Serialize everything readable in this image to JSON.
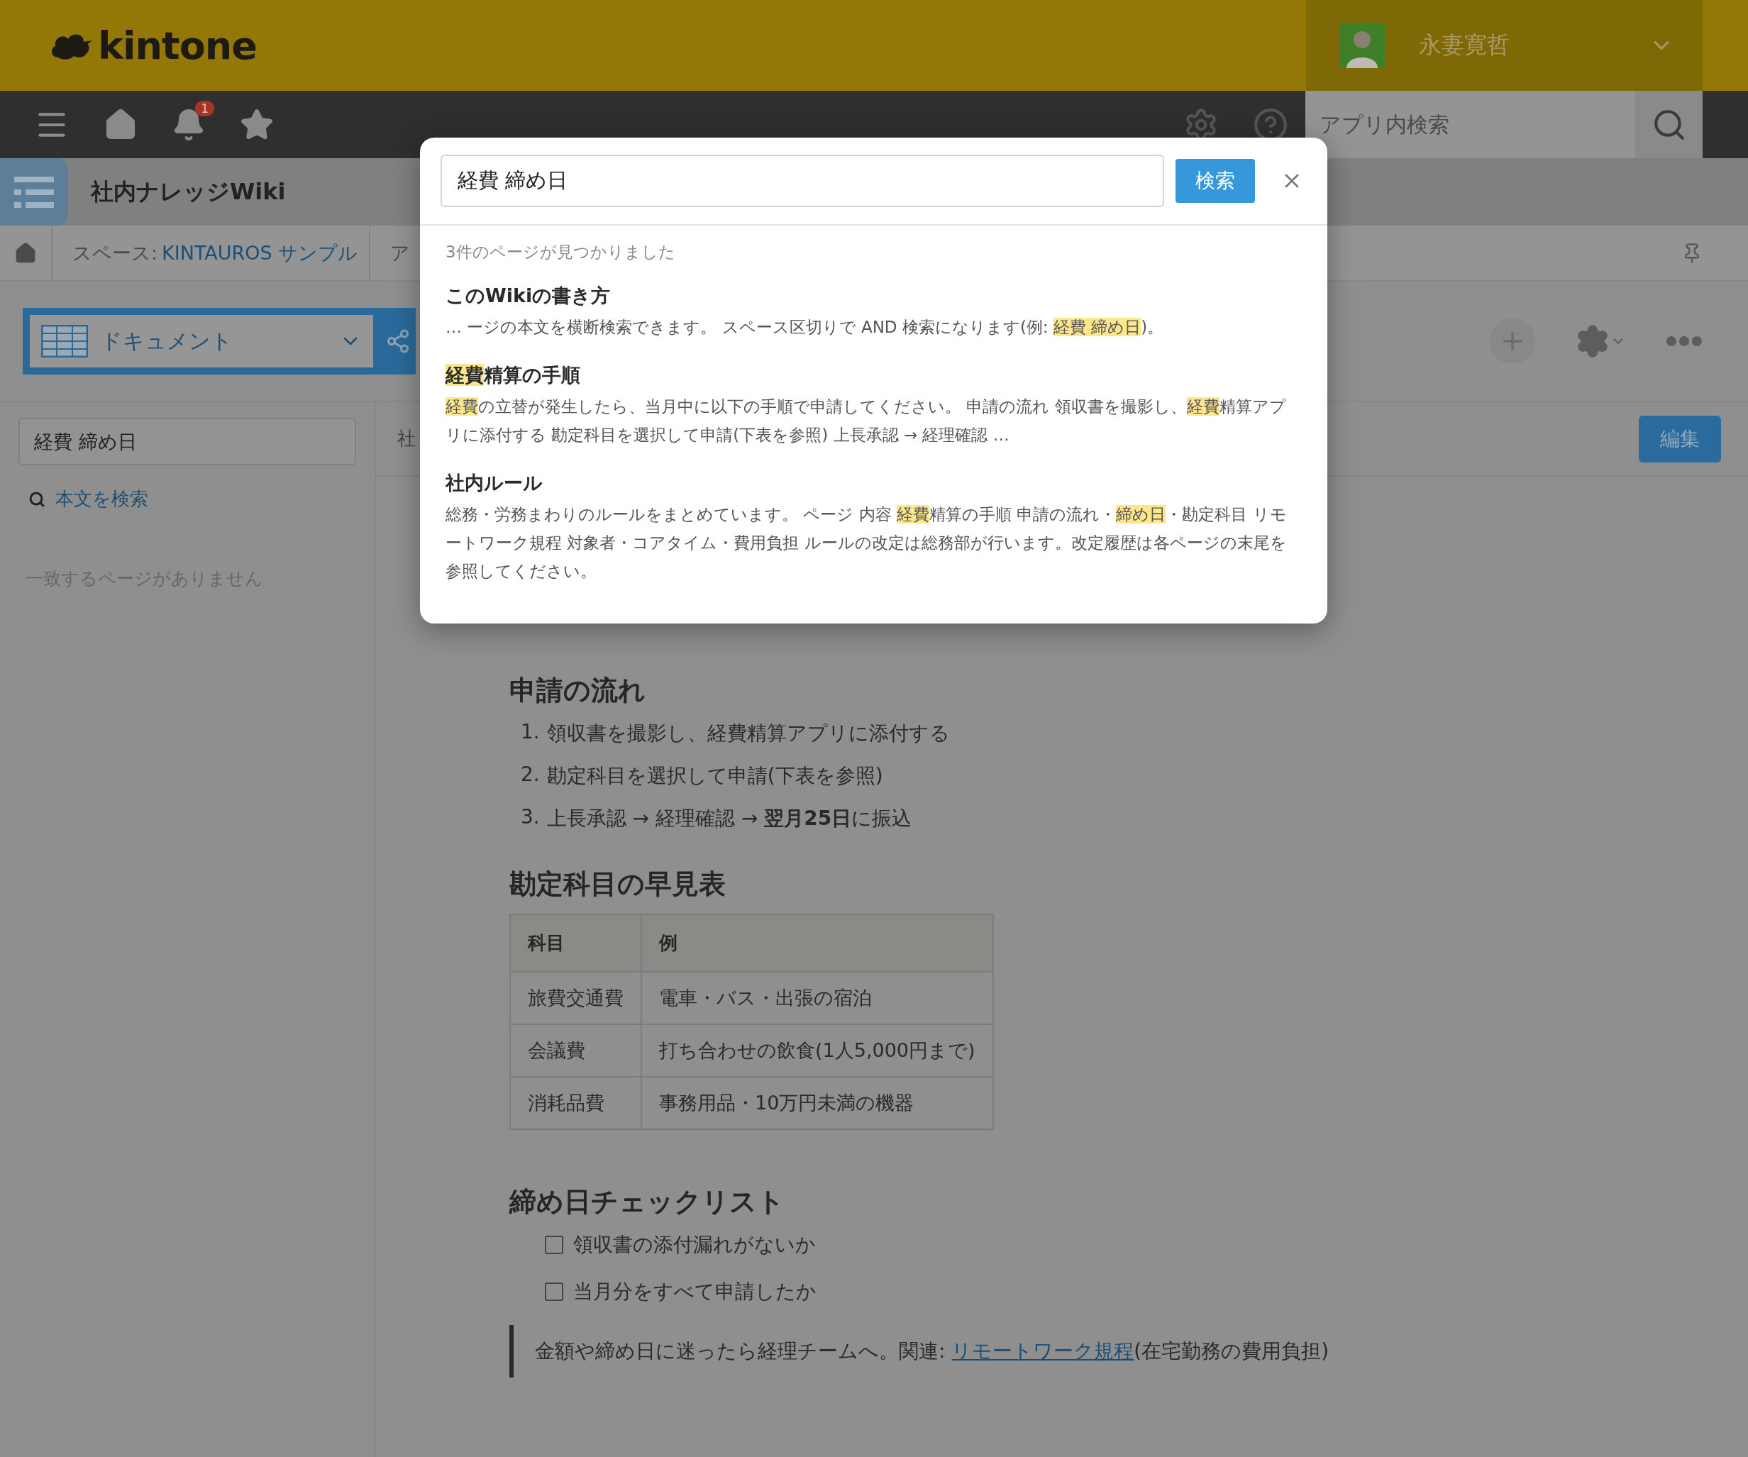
{
  "header": {
    "logo": "kintone",
    "user": {
      "name": "永妻寛哲"
    }
  },
  "nav": {
    "notification_count": "1",
    "search": {
      "placeholder": "アプリ内検索"
    }
  },
  "app": {
    "title": "社内ナレッジWiki"
  },
  "breadcrumb": [
    {
      "label": "スペース:",
      "link": "KINTAUROS サンプル"
    },
    {
      "label": "ア"
    }
  ],
  "view_selector": {
    "label": "ドキュメント"
  },
  "sidebar": {
    "search_value": "経費 締め日",
    "body_search_link": "本文を検索",
    "empty_message": "一致するページがありません"
  },
  "content": {
    "title": "社",
    "edit_button": "編集",
    "blocks": [
      {
        "kind": "heading",
        "text": "申請の流れ"
      },
      {
        "kind": "ordered_list",
        "items": [
          {
            "number": "1.",
            "text": "領収書を撮影し、経費精算アプリに添付する"
          },
          {
            "number": "2.",
            "text": "勘定科目を選択して申請(下表を参照)"
          },
          {
            "number": "3.",
            "text": "上長承認 → 経理確認 → **翌月25日**に振込"
          }
        ]
      },
      {
        "kind": "heading",
        "text": "勘定科目の早見表"
      },
      {
        "kind": "table",
        "columns": [
          "科目",
          "例"
        ],
        "rows": [
          [
            "旅費交通費",
            "電車・バス・出張の宿泊"
          ],
          [
            "会議費",
            "打ち合わせの飲食(1人5,000円まで)"
          ],
          [
            "消耗品費",
            "事務用品・10万円未満の機器"
          ]
        ]
      },
      {
        "kind": "heading",
        "text": "締め日チェックリスト"
      },
      {
        "kind": "checklist",
        "items": [
          {
            "text": "領収書の添付漏れがないか",
            "checked": false
          },
          {
            "text": "当月分をすべて申請したか",
            "checked": false
          }
        ]
      },
      {
        "kind": "quote",
        "text": "金額や締め日に迷ったら経理チームへ。関連: ",
        "link": "リモートワーク規程",
        "after": "(在宅勤務の費用負担)"
      }
    ]
  },
  "search_dialog": {
    "query": "経費 締め日",
    "search_button": "検索",
    "result_count": "3件のページが見つかりました",
    "results": [
      {
        "title": [
          {
            "text": "このWikiの書き方",
            "highlight": false
          }
        ],
        "snippet": [
          {
            "text": "… ージの本文を横断検索できます。 スペース区切りで AND 検索になります(例: ",
            "highlight": false
          },
          {
            "text": "経費 締め日",
            "highlight": true
          },
          {
            "text": ")。",
            "highlight": false
          }
        ]
      },
      {
        "title": [
          {
            "text": "経費",
            "highlight": true
          },
          {
            "text": "精算の手順",
            "highlight": false
          }
        ],
        "snippet": [
          {
            "text": "経費",
            "highlight": true
          },
          {
            "text": "の立替が発生したら、当月中に以下の手順で申請してください。 申請の流れ 領収書を撮影し、",
            "highlight": false
          },
          {
            "text": "経費",
            "highlight": true
          },
          {
            "text": "精算アプリに添付する 勘定科目を選択して申請(下表を参照) 上長承認 → 経理確認 …",
            "highlight": false
          }
        ]
      },
      {
        "title": [
          {
            "text": "社内ルール",
            "highlight": false
          }
        ],
        "snippet": [
          {
            "text": "総務・労務まわりのルールをまとめています。 ページ 内容 ",
            "highlight": false
          },
          {
            "text": "経費",
            "highlight": true
          },
          {
            "text": "精算の手順 申請の流れ・",
            "highlight": false
          },
          {
            "text": "締め日",
            "highlight": true
          },
          {
            "text": "・勘定科目 リモートワーク規程 対象者・コアタイム・費用負担 ルールの改定は総務部が行います。改定履歴は各ページの末尾を参照してください。",
            "highlight": false
          }
        ]
      }
    ]
  }
}
